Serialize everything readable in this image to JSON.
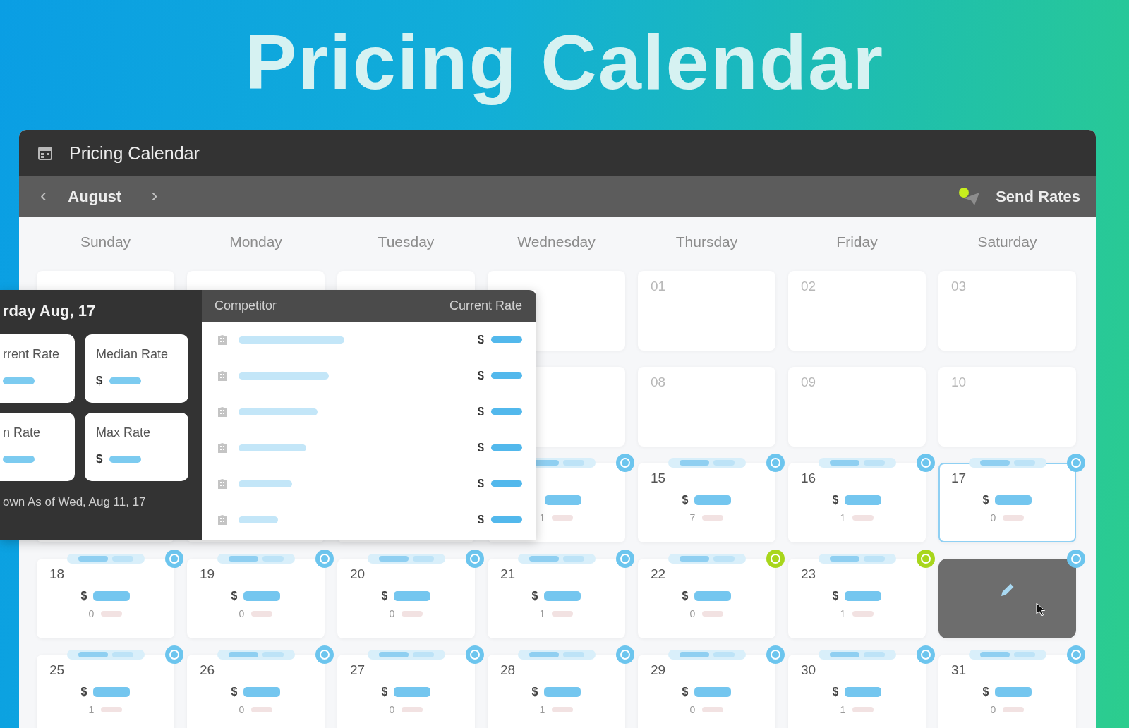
{
  "headline": "Pricing Calendar",
  "window": {
    "title": "Pricing Calendar"
  },
  "toolbar": {
    "previous": "‹",
    "month": "August",
    "next": "›",
    "send_button": {
      "label": "Send Rates",
      "notification": true
    }
  },
  "weekdays": [
    "Sunday",
    "Monday",
    "Tuesday",
    "Wednesday",
    "Thursday",
    "Friday",
    "Saturday"
  ],
  "weeks": [
    [
      {
        "kind": "plain",
        "selected": false,
        "hovered": false
      },
      {
        "kind": "plain",
        "selected": false,
        "hovered": false
      },
      {
        "kind": "plain",
        "selected": false,
        "hovered": false
      },
      {
        "kind": "plain",
        "selected": false,
        "hovered": false
      },
      {
        "kind": "plain",
        "date": "01",
        "selected": false,
        "hovered": false
      },
      {
        "kind": "plain",
        "date": "02",
        "selected": false,
        "hovered": false
      },
      {
        "kind": "plain",
        "date": "03",
        "selected": false,
        "hovered": false
      }
    ],
    [
      {
        "kind": "plain",
        "selected": false,
        "hovered": false
      },
      {
        "kind": "plain",
        "date": "08",
        "selected": false,
        "hovered": false
      },
      {
        "kind": "plain",
        "date": "09",
        "selected": false,
        "hovered": false
      },
      {
        "kind": "plain",
        "date": "10",
        "selected": false,
        "hovered": false
      }
    ],
    [
      {
        "kind": "priced",
        "count": "1",
        "color": "#6cc5ee",
        "selected": false,
        "hovered": false
      },
      {
        "kind": "priced",
        "date": "15",
        "currency": "$",
        "count": "7",
        "color": "#6cc5ee",
        "selected": false,
        "hovered": false
      },
      {
        "kind": "priced",
        "date": "16",
        "currency": "$",
        "count": "1",
        "color": "#6cc5ee",
        "selected": false,
        "hovered": false
      },
      {
        "kind": "priced",
        "date": "17",
        "currency": "$",
        "count": "0",
        "color": "#6cc5ee",
        "selected": true,
        "hovered": false
      }
    ],
    [
      {
        "kind": "priced",
        "date": "18",
        "currency": "$",
        "count": "0",
        "color": "#6cc5ee",
        "selected": false,
        "hovered": false
      },
      {
        "kind": "priced",
        "date": "19",
        "currency": "$",
        "count": "0",
        "color": "#6cc5ee",
        "selected": false,
        "hovered": false
      },
      {
        "kind": "priced",
        "date": "20",
        "currency": "$",
        "count": "0",
        "color": "#6cc5ee",
        "selected": false,
        "hovered": false
      },
      {
        "kind": "priced",
        "date": "21",
        "currency": "$",
        "count": "1",
        "color": "#6cc5ee",
        "selected": false,
        "hovered": false
      },
      {
        "kind": "priced",
        "date": "22",
        "currency": "$",
        "count": "0",
        "color": "#a8d61c",
        "selected": false,
        "hovered": false
      },
      {
        "kind": "priced",
        "date": "23",
        "currency": "$",
        "count": "1",
        "color": "#a8d61c",
        "selected": false,
        "hovered": false
      },
      {
        "kind": "priced",
        "color": "#6cc5ee",
        "selected": false,
        "hovered": true
      }
    ],
    [
      {
        "kind": "priced",
        "date": "25",
        "currency": "$",
        "count": "1",
        "color": "#6cc5ee",
        "selected": false,
        "hovered": false
      },
      {
        "kind": "priced",
        "date": "26",
        "currency": "$",
        "count": "0",
        "color": "#6cc5ee",
        "selected": false,
        "hovered": false
      },
      {
        "kind": "priced",
        "date": "27",
        "currency": "$",
        "count": "0",
        "color": "#6cc5ee",
        "selected": false,
        "hovered": false
      },
      {
        "kind": "priced",
        "date": "28",
        "currency": "$",
        "count": "1",
        "color": "#6cc5ee",
        "selected": false,
        "hovered": false
      },
      {
        "kind": "priced",
        "date": "29",
        "currency": "$",
        "count": "0",
        "color": "#6cc5ee",
        "selected": false,
        "hovered": false
      },
      {
        "kind": "priced",
        "date": "30",
        "currency": "$",
        "count": "1",
        "color": "#6cc5ee",
        "selected": false,
        "hovered": false
      },
      {
        "kind": "priced",
        "date": "31",
        "currency": "$",
        "count": "0",
        "color": "#6cc5ee",
        "selected": false,
        "hovered": false
      }
    ]
  ],
  "day_popup": {
    "title": "rday Aug, 17",
    "stats": [
      {
        "label": "rrent Rate"
      },
      {
        "label": "Median Rate",
        "currency": "$"
      },
      {
        "label": "n Rate"
      },
      {
        "label": "Max Rate",
        "currency": "$"
      }
    ],
    "note": "own As of Wed, Aug 11, 17",
    "columns": [
      "Competitor",
      "Current Rate"
    ],
    "rows": [
      {
        "currency": "$"
      },
      {
        "currency": "$"
      },
      {
        "currency": "$"
      },
      {
        "currency": "$"
      },
      {
        "currency": "$"
      },
      {
        "currency": "$"
      }
    ]
  }
}
